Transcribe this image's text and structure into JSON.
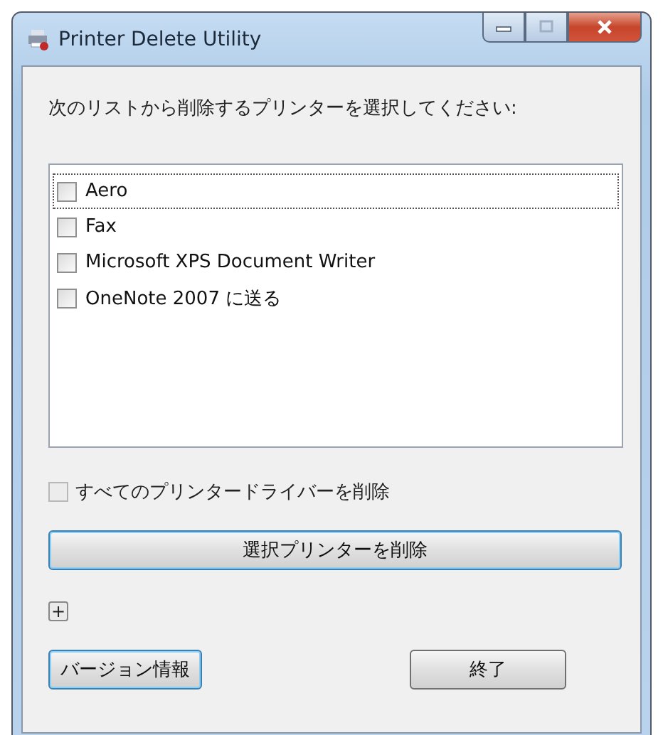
{
  "window": {
    "title": "Printer Delete Utility"
  },
  "prompt": "次のリストから削除するプリンターを選択してください:",
  "printers": [
    {
      "name": "Aero",
      "checked": false,
      "focused": true
    },
    {
      "name": "Fax",
      "checked": false,
      "focused": false
    },
    {
      "name": "Microsoft XPS Document Writer",
      "checked": false,
      "focused": false
    },
    {
      "name": "OneNote 2007 に送る",
      "checked": false,
      "focused": false
    }
  ],
  "delete_all_drivers": {
    "label": "すべてのプリンタードライバーを削除",
    "checked": false,
    "disabled": true
  },
  "delete_button": {
    "label": "選択プリンターを削除",
    "focused": true
  },
  "expander": {
    "label": "+",
    "expanded": false
  },
  "version_button": {
    "label": "バージョン情報"
  },
  "exit_button": {
    "label": "終了"
  }
}
